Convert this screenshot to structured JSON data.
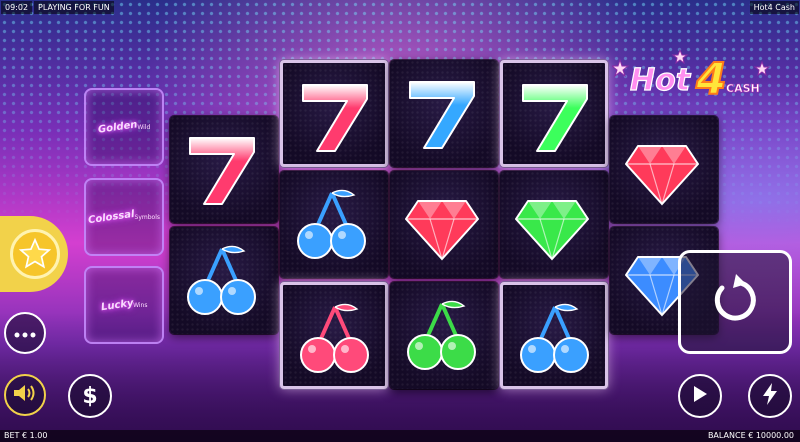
{
  "top_bar": {
    "time": "09:02",
    "mode": "PLAYING FOR FUN",
    "game_name": "Hot4 Cash"
  },
  "logo": {
    "word1": "Hot",
    "digit": "4",
    "word2": "CASH"
  },
  "feature_panels": [
    {
      "title": "Golden",
      "subtitle": "Wild",
      "name": "feature-panel-golden"
    },
    {
      "title": "Colossal",
      "subtitle": "Symbols",
      "name": "feature-panel-colossal"
    },
    {
      "title": "Lucky",
      "subtitle": "Wins",
      "name": "feature-panel-lucky"
    }
  ],
  "reels": {
    "columns": [
      {
        "cells": [
          "seven-red",
          "cherries-blue"
        ]
      },
      {
        "cells": [
          "seven-red",
          "cherries-blue",
          "cherries-red"
        ]
      },
      {
        "cells": [
          "seven-blue",
          "gem-red",
          "cherries-green"
        ]
      },
      {
        "cells": [
          "seven-green",
          "gem-green",
          "cherries-blue"
        ]
      },
      {
        "cells": [
          "gem-red",
          "gem-blue"
        ]
      }
    ],
    "framed_columns": [
      1,
      3
    ]
  },
  "controls": {
    "star_button": "star-icon",
    "menu_button": "more-icon",
    "sound_button": "speaker-icon",
    "bet_button": "dollar-icon",
    "spin_button": "spin-icon",
    "autoplay_button": "play-icon",
    "turbo_button": "lightning-icon"
  },
  "bottom_bar": {
    "bet_label": "BET",
    "bet_value": "€ 1.00",
    "balance_label": "BALANCE",
    "balance_value": "€ 10000.00"
  },
  "colors": {
    "accent_yellow": "#f2d24a",
    "seven_red": "#ff3b6e",
    "seven_blue": "#35a8ff",
    "seven_green": "#3cff5c",
    "gem_red": "#ff3a5a",
    "gem_green": "#39e84a",
    "gem_blue": "#3c8cff",
    "cherry_blue": "#3aa0ff",
    "cherry_red": "#ff4a7a",
    "cherry_green": "#3cdc48"
  }
}
